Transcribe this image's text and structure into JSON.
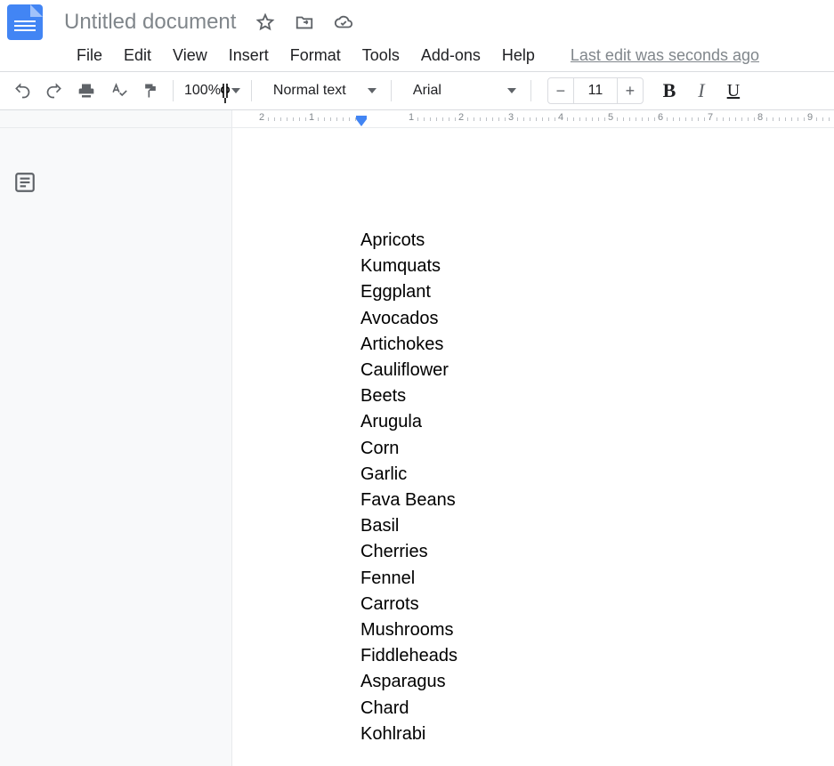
{
  "header": {
    "title": "Untitled document",
    "icons": {
      "star": "star-icon",
      "move": "move-to-folder-icon",
      "cloud": "cloud-saved-icon"
    }
  },
  "menubar": {
    "items": [
      "File",
      "Edit",
      "View",
      "Insert",
      "Format",
      "Tools",
      "Add-ons",
      "Help"
    ],
    "last_edit": "Last edit was seconds ago"
  },
  "toolbar": {
    "zoom": "100%",
    "paragraph_style": "Normal text",
    "font_family": "Arial",
    "font_size": "11"
  },
  "ruler": {
    "labels": [
      "2",
      "1",
      "1",
      "2",
      "3",
      "4",
      "5",
      "6",
      "7",
      "8",
      "9"
    ]
  },
  "document": {
    "lines": [
      "Apricots",
      "Kumquats",
      "Eggplant",
      "Avocados",
      "Artichokes",
      "Cauliflower",
      "Beets",
      "Arugula",
      "Corn",
      "Garlic",
      "Fava Beans",
      "Basil",
      "Cherries",
      "Fennel",
      "Carrots",
      "Mushrooms",
      "Fiddleheads",
      "Asparagus",
      "Chard",
      "Kohlrabi"
    ]
  }
}
